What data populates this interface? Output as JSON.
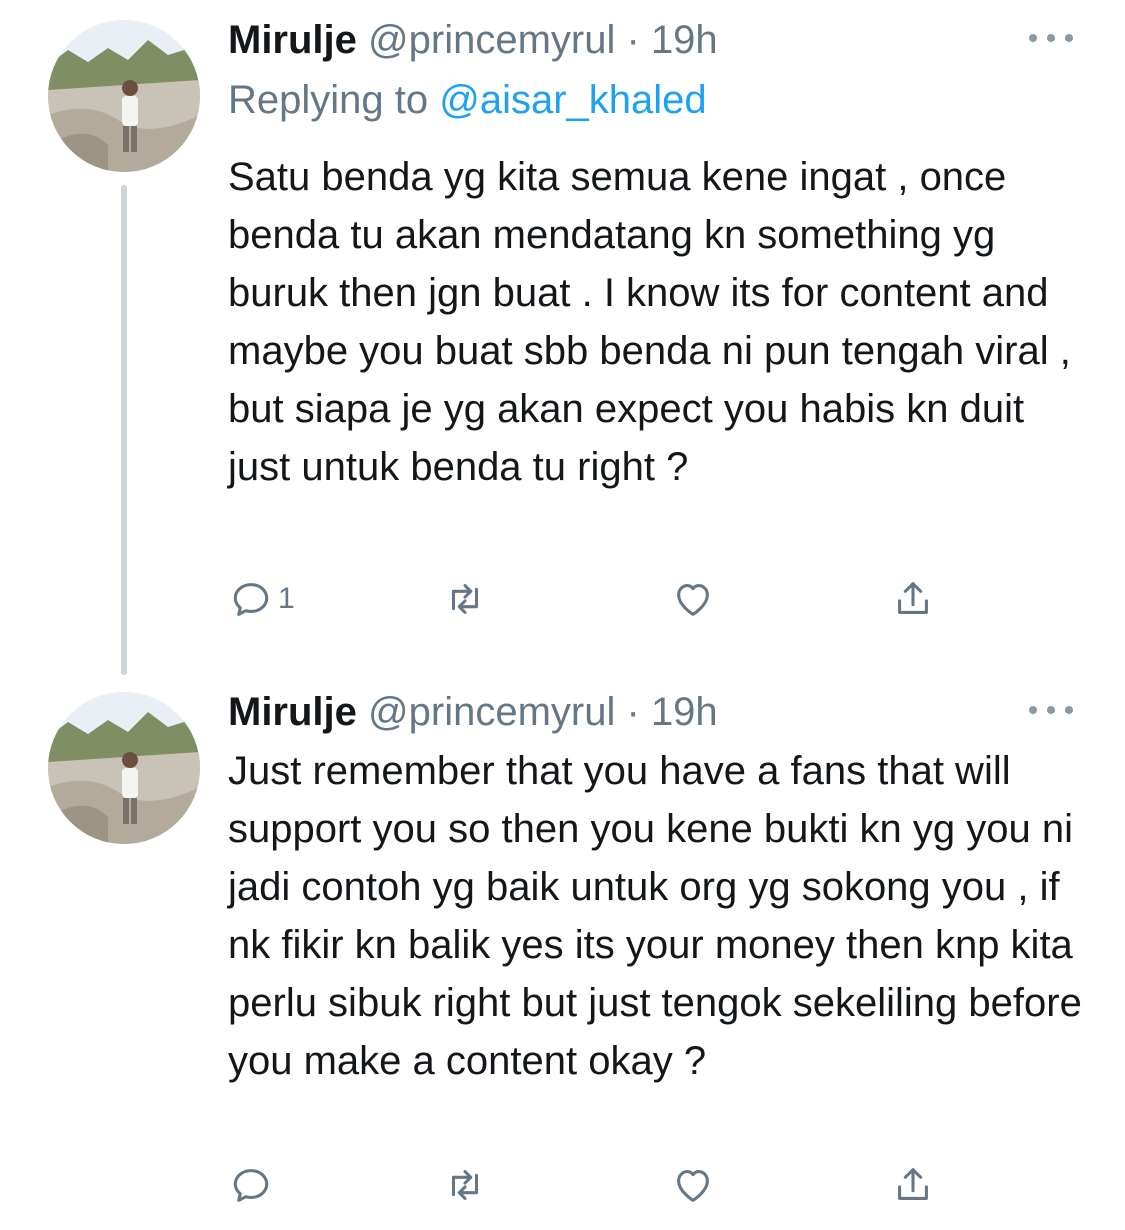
{
  "tweets": [
    {
      "name": "Mirulje",
      "handle": "@princemyrul",
      "dot": "·",
      "time": "19h",
      "replying_prefix": "Replying to",
      "replying_to": "@aisar_khaled",
      "text": "Satu benda yg kita semua kene ingat , once benda tu akan mendatang kn something yg buruk then jgn buat . I know its for content and maybe you buat sbb benda ni pun tengah viral , but siapa je yg akan expect you habis kn duit just untuk benda tu right ?",
      "reply_count": "1",
      "icons": [
        "reply-icon",
        "retweet-icon",
        "like-icon",
        "share-icon",
        "more-icon"
      ]
    },
    {
      "name": "Mirulje",
      "handle": "@princemyrul",
      "dot": "·",
      "time": "19h",
      "text": "Just remember that you have a fans that will support you so then you kene bukti kn yg you ni jadi contoh yg baik untuk org yg sokong you , if nk fikir kn balik yes its your money then knp kita perlu sibuk right but just tengok sekeliling before you make a content okay ?",
      "icons": [
        "reply-icon",
        "retweet-icon",
        "like-icon",
        "share-icon",
        "more-icon"
      ]
    }
  ],
  "colors": {
    "text": "#14171a",
    "secondary": "#657786",
    "mention": "#1da1f2",
    "thread_line": "#cdd5dc"
  }
}
